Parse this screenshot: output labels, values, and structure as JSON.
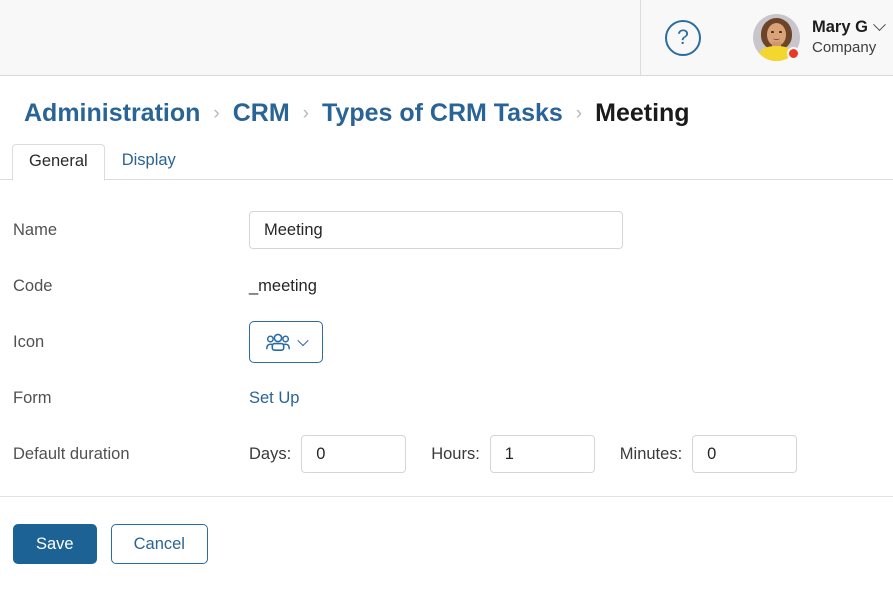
{
  "header": {
    "help_icon": "question-circle-icon",
    "user": {
      "name": "Mary G",
      "company": "Company",
      "avatar_icon": "user-avatar-photo",
      "status": "online",
      "dropdown_icon": "chevron-down-icon"
    }
  },
  "breadcrumb": {
    "separator": "›",
    "items": [
      {
        "label": "Administration",
        "current": false
      },
      {
        "label": "CRM",
        "current": false
      },
      {
        "label": "Types of CRM Tasks",
        "current": false
      },
      {
        "label": "Meeting",
        "current": true
      }
    ]
  },
  "tabs": [
    {
      "label": "General",
      "active": true
    },
    {
      "label": "Display",
      "active": false
    }
  ],
  "form": {
    "name": {
      "label": "Name",
      "value": "Meeting",
      "placeholder": ""
    },
    "code": {
      "label": "Code",
      "value": "_meeting"
    },
    "icon": {
      "label": "Icon",
      "selected_icon": "group-people-icon",
      "chevron": "chevron-down-icon"
    },
    "form_setup": {
      "label": "Form",
      "link_label": "Set Up"
    },
    "default_duration": {
      "label": "Default duration",
      "days": {
        "label": "Days:",
        "value": "0"
      },
      "hours": {
        "label": "Hours:",
        "value": "1"
      },
      "minutes": {
        "label": "Minutes:",
        "value": "0"
      }
    }
  },
  "footer": {
    "save_label": "Save",
    "cancel_label": "Cancel"
  },
  "colors": {
    "link_blue": "#2a6496",
    "primary_button": "#1d6294",
    "status_red": "#e8392b",
    "header_bg": "#f8f8f8",
    "border_gray": "#dcdcdc"
  }
}
